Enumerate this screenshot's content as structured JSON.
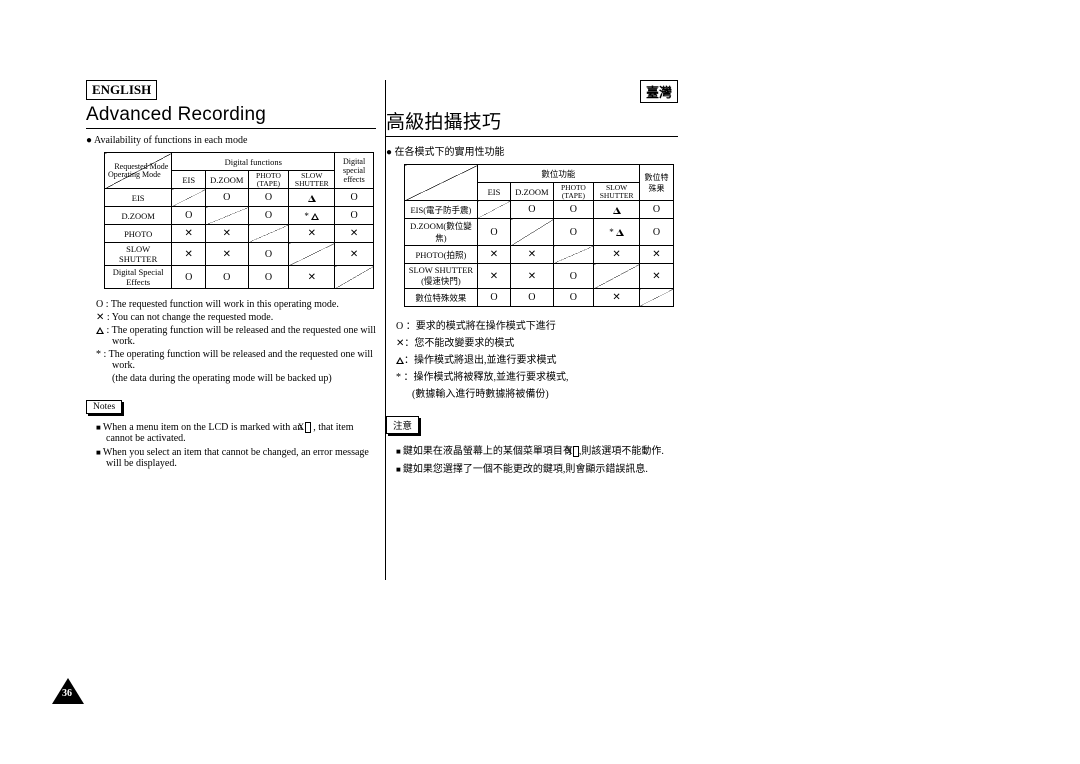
{
  "left": {
    "lang": "ENGLISH",
    "title": "Advanced Recording",
    "section": "Availability of functions in each mode",
    "table": {
      "diag1": "Requested Mode",
      "diag2": "Operating Mode",
      "header_group": "Digital functions",
      "header_dse": "Digital special effects",
      "cols": [
        "EIS",
        "D.ZOOM",
        "PHOTO (TAPE)",
        "SLOW SHUTTER"
      ],
      "rows": [
        {
          "h": "EIS",
          "c": [
            "",
            "O",
            "O",
            "tri",
            "O"
          ]
        },
        {
          "h": "D.ZOOM",
          "c": [
            "O",
            "",
            "O",
            "*tri",
            "O"
          ]
        },
        {
          "h": "PHOTO",
          "c": [
            "X",
            "X",
            "",
            "X",
            "X"
          ]
        },
        {
          "h": "SLOW SHUTTER",
          "c": [
            "X",
            "X",
            "O",
            "",
            "X"
          ]
        },
        {
          "h": "Digital Special Effects",
          "c": [
            "O",
            "O",
            "O",
            "X",
            ""
          ]
        }
      ]
    },
    "legend": {
      "o": "O : The requested function will work in this operating mode.",
      "x": "✕ : You can not change the requested mode.",
      "t": ": The operating function will be released and the requested one will work.",
      "star": "* : The operating function will be released and the requested one will work.",
      "star2": "(the data during the operating mode will be backed up)"
    },
    "notes_label": "Notes",
    "notes": {
      "n1a": "When a menu item on the LCD is marked with an ",
      "n1b": ", that item cannot be activated.",
      "n2": "When you select an item that cannot be changed, an error message will be displayed."
    }
  },
  "right": {
    "lang": "臺灣",
    "title": "高級拍攝技巧",
    "section": "在各模式下的實用性功能",
    "table": {
      "header_group": "數位功能",
      "header_dse": "數位特殊果",
      "cols": [
        "EIS",
        "D.ZOOM",
        "PHOTO (TAPE)",
        "SLOW SHUTTER"
      ],
      "rows": [
        {
          "h": "EIS(電子防手震)",
          "c": [
            "",
            "O",
            "O",
            "tri",
            "O"
          ]
        },
        {
          "h": "D.ZOOM(數位變焦)",
          "c": [
            "O",
            "",
            "O",
            "*tri",
            "O"
          ]
        },
        {
          "h": "PHOTO(拍照)",
          "c": [
            "X",
            "X",
            "",
            "X",
            "X"
          ]
        },
        {
          "h": "SLOW SHUTTER (慢速快門)",
          "c": [
            "X",
            "X",
            "O",
            "",
            "X"
          ]
        },
        {
          "h": "數位特殊效果",
          "c": [
            "O",
            "O",
            "O",
            "X",
            ""
          ]
        }
      ]
    },
    "legend": {
      "o": "O ：要求的模式將在操作模式下進行",
      "x": "✕：您不能改變要求的模式",
      "t": "：操作模式將退出,並進行要求模式",
      "star": "* ：操作模式將被釋放,並進行要求模式,",
      "star2": "(數據輸入進行時數據將被備份)"
    },
    "notes_label": "注意",
    "notes": {
      "n1a": "鍵如果在液晶螢幕上的某個菜單項目有",
      "n1b": ",則該選項不能動作.",
      "n2": "鍵如果您選擇了一個不能更改的鍵項,則會顯示錯誤訊息."
    }
  },
  "page_number": "36",
  "xbox": "X"
}
